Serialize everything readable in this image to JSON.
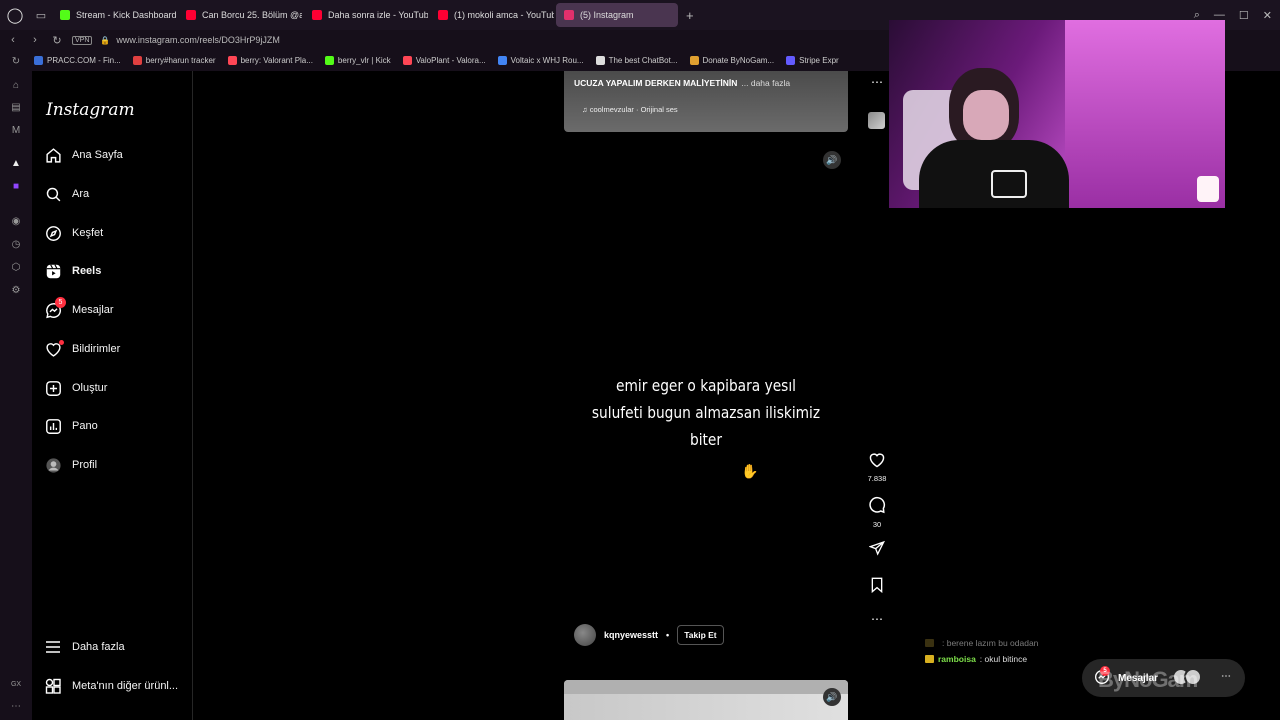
{
  "browser": {
    "tabs": [
      {
        "label": "Stream - Kick Dashboard",
        "color": "#53fc18",
        "active": false
      },
      {
        "label": "Can Borcu 25. Bölüm @at",
        "color": "#ff0033",
        "active": false
      },
      {
        "label": "Daha sonra izle - YouTube",
        "color": "#ff0033",
        "active": false
      },
      {
        "label": "(1) mokoli amca - YouTube",
        "color": "#ff0033",
        "active": false
      },
      {
        "label": "(5) Instagram",
        "color": "#e1306c",
        "active": true
      }
    ],
    "vpn_label": "VPN",
    "url": "www.instagram.com/reels/DO3HrP9jJZM",
    "bookmarks": [
      {
        "label": "PRACC.COM - Fin...",
        "color": "#3a6fd8"
      },
      {
        "label": "berry#harun tracker",
        "color": "#e04040"
      },
      {
        "label": "berry: Valorant Pla...",
        "color": "#ff4655"
      },
      {
        "label": "berry_vlr | Kick",
        "color": "#53fc18"
      },
      {
        "label": "ValoPlant - Valora...",
        "color": "#ff4655"
      },
      {
        "label": "Voltaic x WHJ Rou...",
        "color": "#4285f4"
      },
      {
        "label": "The best ChatBot...",
        "color": "#dddddd"
      },
      {
        "label": "Donate ByNoGam...",
        "color": "#e0a030"
      },
      {
        "label": "Stripe Expr",
        "color": "#635bff"
      }
    ]
  },
  "instagram": {
    "logo": "Instagram",
    "nav": [
      {
        "label": "Ana Sayfa",
        "icon": "home-icon",
        "bold": false
      },
      {
        "label": "Ara",
        "icon": "search-icon",
        "bold": false
      },
      {
        "label": "Keşfet",
        "icon": "compass-icon",
        "bold": false
      },
      {
        "label": "Reels",
        "icon": "reels-icon",
        "bold": true
      },
      {
        "label": "Mesajlar",
        "icon": "messenger-icon",
        "bold": false,
        "badge": "5"
      },
      {
        "label": "Bildirimler",
        "icon": "heart-icon",
        "bold": false
      },
      {
        "label": "Oluştur",
        "icon": "plus-icon",
        "bold": false
      },
      {
        "label": "Pano",
        "icon": "dashboard-icon",
        "bold": false
      },
      {
        "label": "Profil",
        "icon": "profile-icon",
        "bold": false
      }
    ],
    "more_label": "Daha fazla",
    "meta_label": "Meta'nın diğer ürünl...",
    "reel_prev": {
      "caption": "UCUZA YAPALIM DERKEN MALİYETİNİN",
      "more": "... daha fazla",
      "audio": "coolmevzular · Orijinal ses"
    },
    "reel": {
      "text_lines": [
        "emir eger o kapibara yesıl",
        "sulufeti bugun almazsan iliskimiz",
        "biter"
      ],
      "author": "kqnyewesstt",
      "separator": "•",
      "follow_label": "Takip Et",
      "likes": "7.838",
      "comments": "30"
    }
  },
  "stream_overlay": {
    "chat": [
      {
        "user": "",
        "message": ": berene lazım bu odadan",
        "user_color": "#e05050",
        "faded": true
      },
      {
        "user": "ramboisa",
        "message": ": okul bitince",
        "user_color": "#7ee04a",
        "faded": false
      }
    ],
    "messages_pill": {
      "label": "Mesajlar",
      "badge": "5"
    },
    "watermark": "ByNoGam"
  }
}
